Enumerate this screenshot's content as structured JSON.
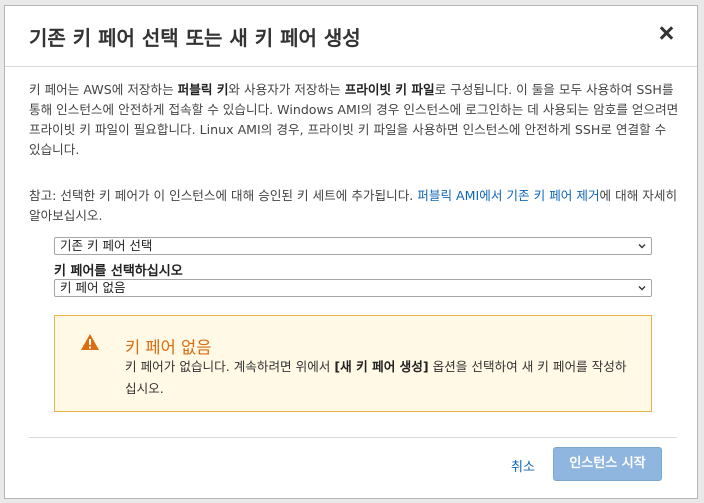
{
  "dialog": {
    "title": "기존 키 페어 선택 또는 새 키 페어 생성",
    "intro": {
      "t1": "키 페어는 AWS에 저장하는 ",
      "b1": "퍼블릭 키",
      "t2": "와 사용자가 저장하는 ",
      "b2": "프라이빗 키 파일",
      "t3": "로 구성됩니다. 이 둘을 모두 사용하여 SSH를 통해 인스턴스에 안전하게 접속할 수 있습니다. Windows AMI의 경우 인스턴스에 로그인하는 데 사용되는 암호를 얻으려면 프라이빗 키 파일이 필요합니다. Linux AMI의 경우, 프라이빗 키 파일을 사용하면 인스턴스에 안전하게 SSH로 연결할 수 있습니다."
    },
    "note": {
      "text": "참고: 선택한 키 페어가 이 인스턴스에 대해 승인된 키 세트에 추가됩니다. ",
      "link": "퍼블릭 AMI에서 기존 키 페어 제거",
      "suffix": "에 대해 자세히 알아보십시오."
    },
    "key_pair_option": {
      "selected": "기존 키 페어 선택"
    },
    "key_pair_select": {
      "label": "키 페어를 선택하십시오",
      "selected": "키 페어 없음"
    },
    "alert": {
      "title": "키 페어 없음",
      "t1": "키 페어가 없습니다. 계속하려면 위에서 ",
      "b1": "[새 키 페어 생성]",
      "t2": " 옵션을 선택하여 새 키 페어를 작성하십시오.",
      "color": "#dd6b10"
    },
    "footer": {
      "cancel_label": "취소",
      "launch_label": "인스턴스 시작"
    }
  }
}
